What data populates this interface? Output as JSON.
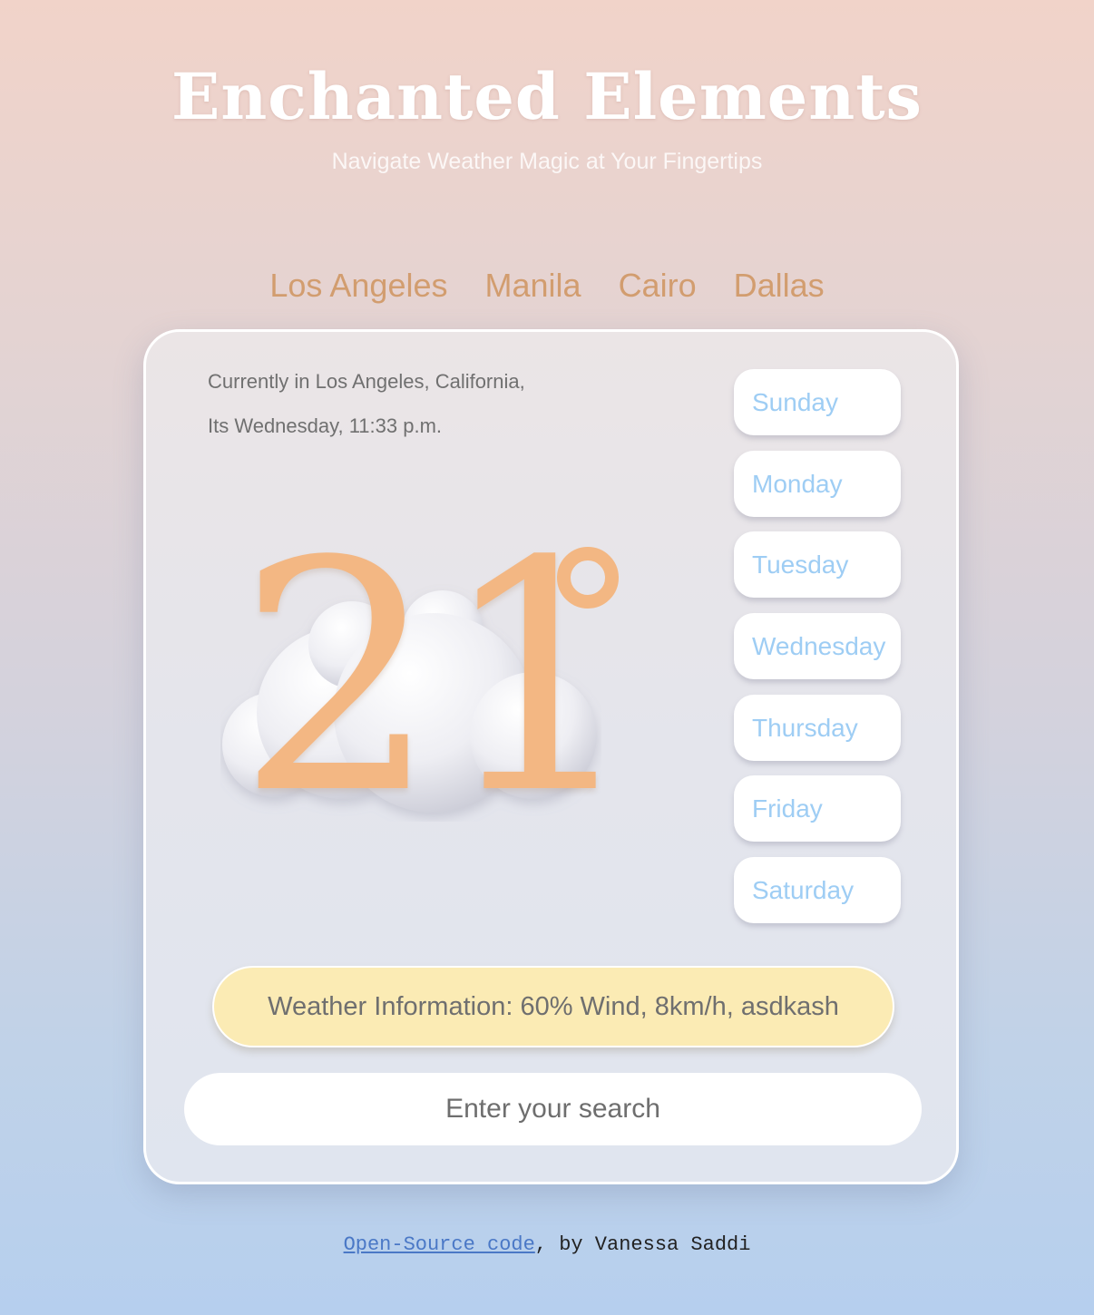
{
  "header": {
    "title": "Enchanted Elements",
    "subtitle": "Navigate Weather Magic at Your Fingertips"
  },
  "cities": [
    "Los Angeles",
    "Manila",
    "Cairo",
    "Dallas"
  ],
  "current": {
    "location_line": "Currently in Los Angeles, California,",
    "time_line": "Its Wednesday, 11:33 p.m.",
    "temperature": "21",
    "weather_icon": "cloud-icon"
  },
  "days": [
    "Sunday",
    "Monday",
    "Tuesday",
    "Wednesday",
    "Thursday",
    "Friday",
    "Saturday"
  ],
  "info": "Weather Information: 60% Wind, 8km/h, asdkash",
  "search": {
    "value": "",
    "placeholder": "Enter your search"
  },
  "footer": {
    "link_text": "Open-Source code",
    "suffix": ", by Vanessa Saddi"
  },
  "colors": {
    "accent_city": "#d29d6f",
    "temperature": "#f3b783",
    "day_text": "#9ecdf4",
    "info_pill": "#fbebb4",
    "link": "#4a78c6"
  }
}
